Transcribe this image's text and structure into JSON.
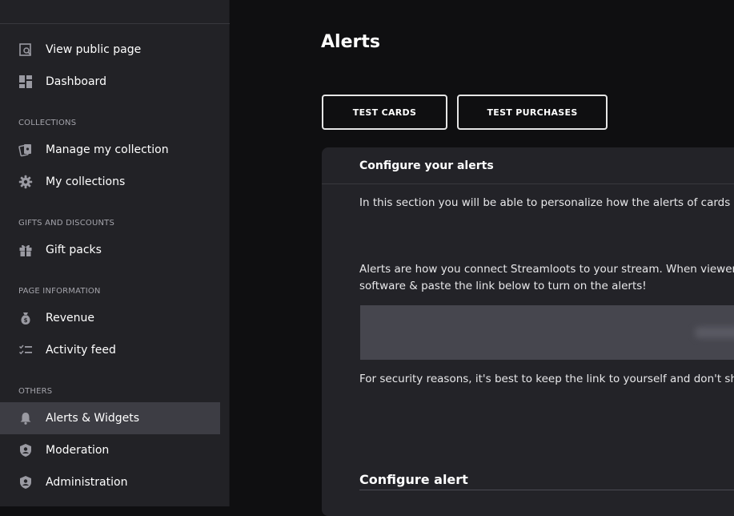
{
  "sidebar": {
    "items_top": [
      {
        "label": "View public page",
        "icon": "search-page-icon"
      },
      {
        "label": "Dashboard",
        "icon": "dashboard-icon"
      }
    ],
    "sections": [
      {
        "title": "COLLECTIONS",
        "items": [
          {
            "label": "Manage my collection",
            "icon": "cards-icon"
          },
          {
            "label": "My collections",
            "icon": "gear-icon"
          }
        ]
      },
      {
        "title": "GIFTS AND DISCOUNTS",
        "items": [
          {
            "label": "Gift packs",
            "icon": "gift-icon"
          }
        ]
      },
      {
        "title": "PAGE INFORMATION",
        "items": [
          {
            "label": "Revenue",
            "icon": "money-bag-icon"
          },
          {
            "label": "Activity feed",
            "icon": "checklist-icon"
          }
        ]
      },
      {
        "title": "OTHERS",
        "items": [
          {
            "label": "Alerts & Widgets",
            "icon": "bell-icon",
            "active": true
          },
          {
            "label": "Moderation",
            "icon": "shield-user-icon"
          },
          {
            "label": "Administration",
            "icon": "shield-user-icon"
          }
        ]
      }
    ]
  },
  "main": {
    "title": "Alerts",
    "buttons": {
      "test_cards": "TEST CARDS",
      "test_purchases": "TEST PURCHASES"
    },
    "card": {
      "header": "Configure your alerts",
      "intro": "In this section you will be able to personalize how the alerts of cards and",
      "alerts_line1": "Alerts are how you connect Streamloots to your stream. When viewers r",
      "alerts_line2": "software & paste the link below to turn on the alerts!",
      "link_value": "",
      "security_note": "For security reasons, it's best to keep the link to yourself and don't share",
      "configure_alert_title": "Configure alert"
    }
  },
  "colors": {
    "sidebar_bg": "#222226",
    "active_item_bg": "#3d3d44",
    "main_bg": "#0f0f11",
    "card_bg": "#232328",
    "link_box_bg": "#46464e"
  }
}
